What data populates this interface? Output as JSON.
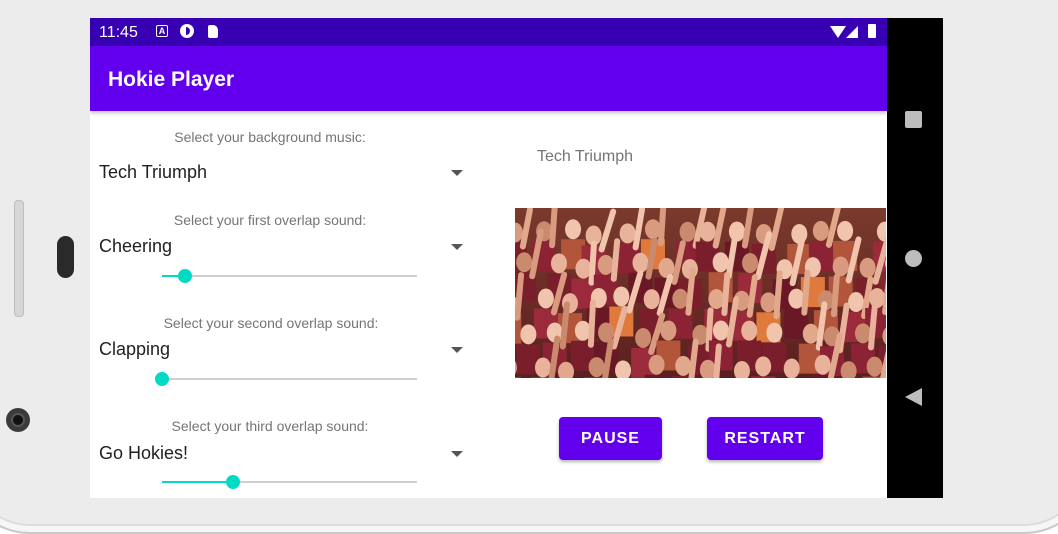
{
  "status_bar": {
    "time": "11:45",
    "notification_icons": [
      "a-icon",
      "pie-icon",
      "sd-card-icon"
    ],
    "system_icons": [
      "wifi-icon",
      "signal-icon",
      "battery-icon"
    ]
  },
  "app_bar": {
    "title": "Hokie Player",
    "color": "#6200ee",
    "status_color": "#3700b3"
  },
  "controls": {
    "background": {
      "label": "Select your background music:",
      "value": "Tech Triumph"
    },
    "overlap1": {
      "label": "Select your first overlap sound:",
      "value": "Cheering",
      "volume": 0.09
    },
    "overlap2": {
      "label": "Select your second overlap sound:",
      "value": "Clapping",
      "volume": 0.0
    },
    "overlap3": {
      "label": "Select your third overlap sound:",
      "value": "Go Hokies!",
      "volume": 0.28
    }
  },
  "player": {
    "now_playing": "Tech Triumph",
    "image": "crowd-cheering-photo",
    "pause_label": "PAUSE",
    "restart_label": "RESTART"
  },
  "nav": [
    "recents-icon",
    "home-icon",
    "back-icon"
  ],
  "accent": "#03dac5"
}
